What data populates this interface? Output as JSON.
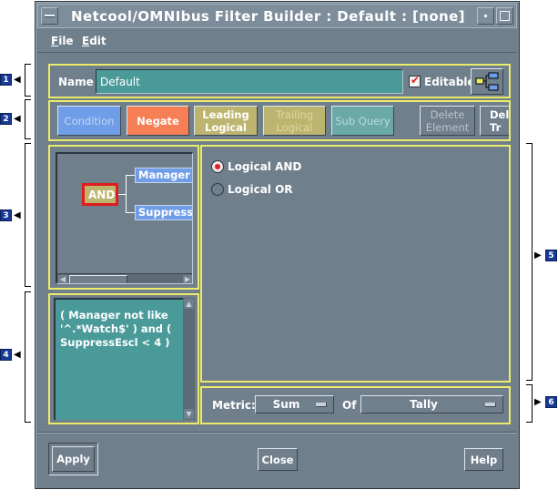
{
  "window": {
    "title": "Netcool/OMNIbus Filter Builder : Default : [none]"
  },
  "menu": {
    "file_mnemonic": "F",
    "file_rest": "ile",
    "edit_mnemonic": "E",
    "edit_rest": "dit"
  },
  "callouts": [
    "1",
    "2",
    "3",
    "4",
    "5",
    "6"
  ],
  "name_row": {
    "label": "Name",
    "value": "Default",
    "editable_label": "Editable",
    "editable_checked": true
  },
  "toolbar": {
    "condition": "Condition",
    "negate": "Negate",
    "leading_logical_1": "Leading",
    "leading_logical_2": "Logical",
    "trailing_logical_1": "Trailing",
    "trailing_logical_2": "Logical",
    "sub_query": "Sub Query",
    "delete_element_1": "Delete",
    "delete_element_2": "Element",
    "delete_tree_1": "Del",
    "delete_tree_2": "Tr"
  },
  "tree": {
    "root": "AND",
    "children": [
      "Manager n",
      "SuppressE"
    ]
  },
  "sql_text": "( Manager not like '^.*Watch$' ) and ( SuppressEscl < 4 )",
  "logic_options": [
    {
      "label": "Logical AND",
      "selected": true
    },
    {
      "label": "Logical OR",
      "selected": false
    }
  ],
  "metric": {
    "label": "Metric:",
    "function": "Sum",
    "of_label": "Of",
    "column": "Tally"
  },
  "buttons": {
    "apply": "Apply",
    "close": "Close",
    "help": "Help"
  },
  "colors": {
    "window_bg": "#707f8c",
    "panel_outline": "#ecec6a",
    "field_teal": "#4a9a9a",
    "condition_blue": "#6f9de8",
    "negate_orange": "#f77f55",
    "logical_olive": "#bdb56f",
    "subquery_teal": "#6ba9a9",
    "selected_red": "#e32020"
  }
}
